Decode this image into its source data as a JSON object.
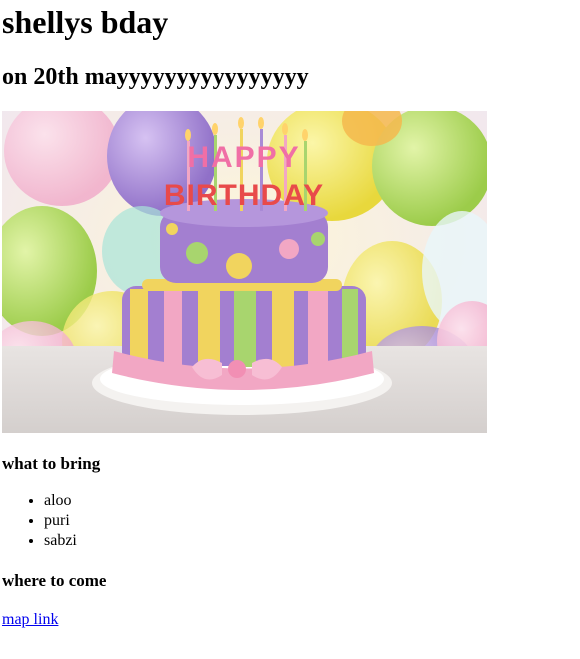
{
  "page": {
    "title": "shellys bday",
    "subtitle": "on 20th mayyyyyyyyyyyyyyyy"
  },
  "hero": {
    "cake_text": "HAPPY BIRTHDAY",
    "colors": {
      "balloon_purple": "#a98ad6",
      "balloon_yellow": "#f3ea5c",
      "balloon_green": "#b7df6a",
      "cake_purple": "#a37fd0",
      "cake_yellow": "#f1d45e",
      "cake_green": "#a8d56e",
      "ribbon_pink": "#f2a7c4"
    }
  },
  "bring": {
    "heading": "what to bring",
    "items": [
      "aloo",
      "puri",
      "sabzi"
    ]
  },
  "where": {
    "heading": "where to come",
    "link_text": "map link"
  }
}
